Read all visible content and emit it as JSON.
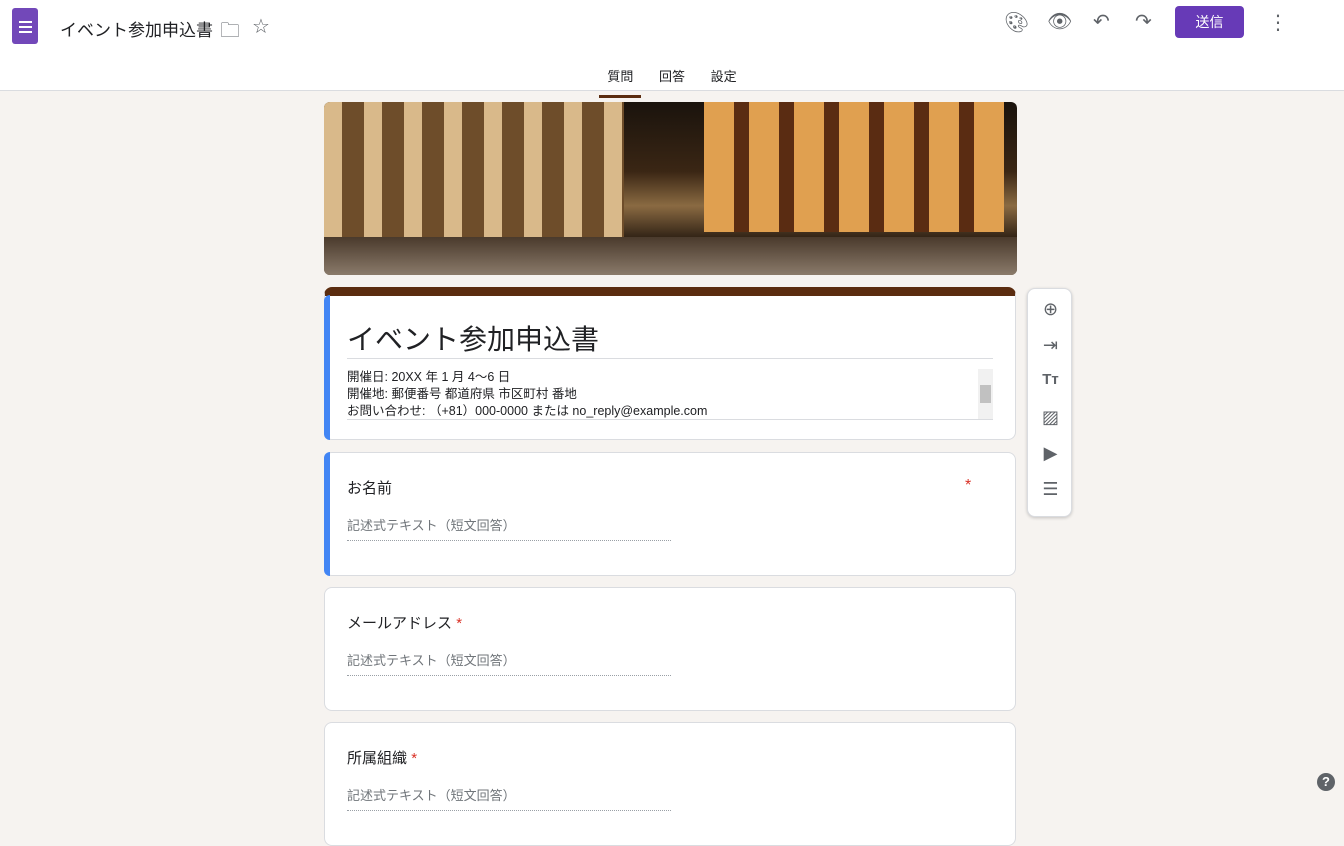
{
  "header": {
    "title": "イベント参加申込書",
    "send_label": "送信"
  },
  "tabs": [
    "質問",
    "回答",
    "設定"
  ],
  "form": {
    "title": "イベント参加申込書",
    "description": [
      "開催日: 20XX 年 1 月 4〜6 日",
      "開催地: 郵便番号 都道府県 市区町村 番地",
      "お問い合わせ: （+81）000-0000 または no_reply@example.com"
    ]
  },
  "questions": [
    {
      "label": "お名前",
      "placeholder": "記述式テキスト（短文回答）",
      "required": "*"
    },
    {
      "label": "メールアドレス",
      "placeholder": "記述式テキスト（短文回答）",
      "required": "*"
    },
    {
      "label": "所属組織",
      "placeholder": "記述式テキスト（短文回答）",
      "required": "*"
    }
  ],
  "colors": {
    "accent": "#673ab7",
    "theme": "#5b2c0f",
    "active_bar": "#4285f4"
  }
}
